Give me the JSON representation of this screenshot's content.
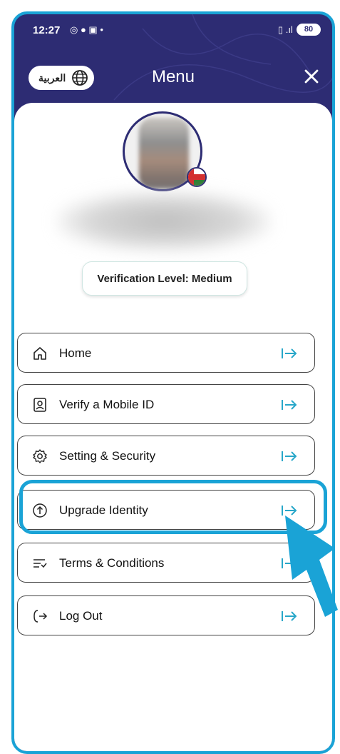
{
  "status": {
    "time": "12:27",
    "battery": "80"
  },
  "header": {
    "language_button": "العربية",
    "title": "Menu"
  },
  "profile": {
    "verification": "Verification Level: Medium"
  },
  "menu_items": [
    {
      "label": "Home",
      "icon": "home-icon"
    },
    {
      "label": "Verify a Mobile ID",
      "icon": "id-badge-icon"
    },
    {
      "label": "Setting & Security",
      "icon": "gear-icon"
    },
    {
      "label": "Upgrade Identity",
      "icon": "upgrade-arrow-icon"
    },
    {
      "label": "Terms & Conditions",
      "icon": "list-check-icon"
    },
    {
      "label": "Log Out",
      "icon": "logout-icon"
    }
  ],
  "colors": {
    "header_bg": "#2d2c73",
    "accent": "#1aa3d6",
    "arrow": "#27a7c9"
  }
}
